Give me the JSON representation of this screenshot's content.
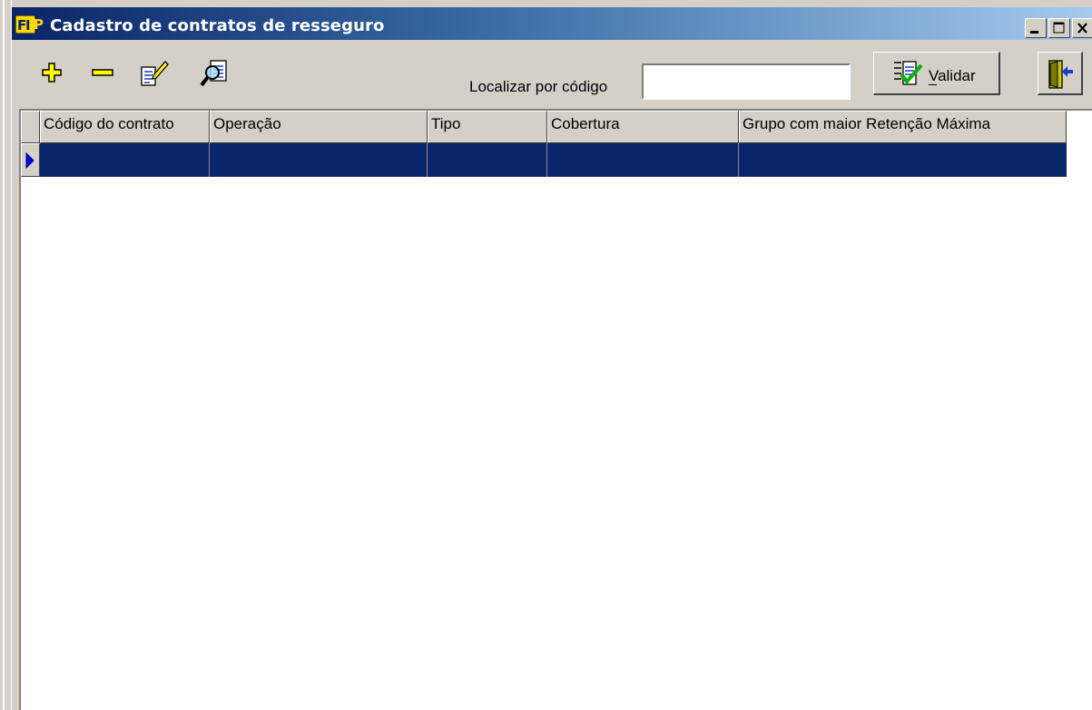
{
  "window": {
    "title": "Cadastro de contratos de resseguro",
    "app_icon": "fp-logo-icon",
    "controls": [
      "minimize-icon",
      "maximize-icon",
      "close-icon"
    ]
  },
  "toolbar": {
    "tools": [
      {
        "name": "add-icon",
        "label": "Adicionar"
      },
      {
        "name": "remove-icon",
        "label": "Remover"
      },
      {
        "name": "edit-icon",
        "label": "Editar"
      },
      {
        "name": "search-icon",
        "label": "Consultar"
      }
    ],
    "find_label": "Localizar por código",
    "find_value": "",
    "validar_label": "Validar",
    "validar_icon": "checklist-icon",
    "exit_icon": "exit-door-icon"
  },
  "grid": {
    "columns": [
      "Código do contrato",
      "Operação",
      "Tipo",
      "Cobertura",
      "Grupo com maior Retenção Máxima"
    ],
    "rows": [
      {
        "selected": true,
        "cells": [
          "",
          "",
          "",
          "",
          ""
        ]
      }
    ]
  },
  "colors": {
    "title_start": "#0a246a",
    "title_end": "#a6caf0",
    "face": "#d4d0c8",
    "selection": "#0a246a",
    "tool_icon_yellow": "#ffff00"
  }
}
